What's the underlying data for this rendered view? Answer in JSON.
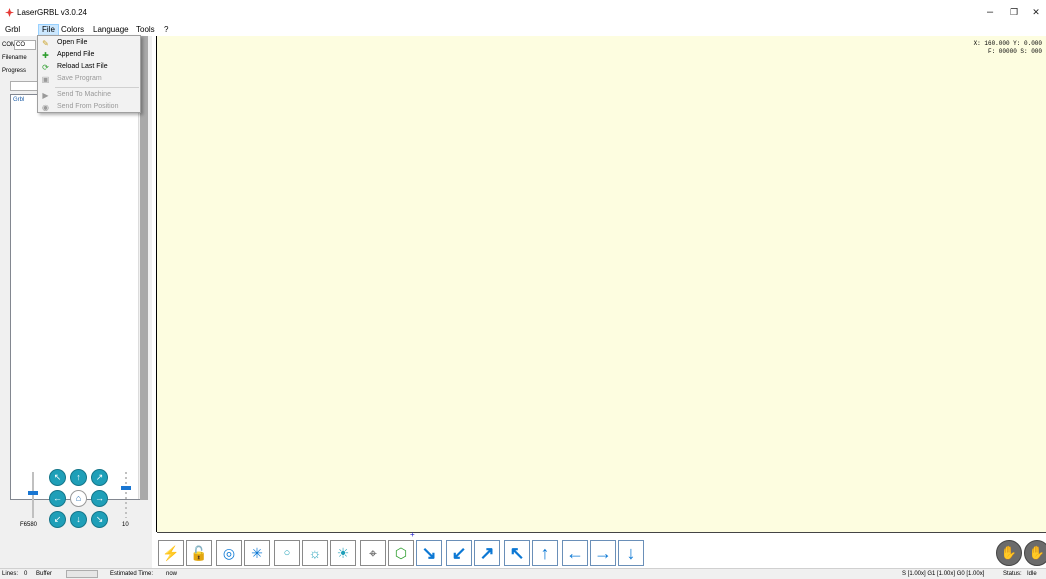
{
  "window": {
    "title": "LaserGRBL v3.0.24",
    "minimize": "–",
    "restore": "❐",
    "close": "✕"
  },
  "menubar": {
    "items": [
      "Grbl",
      "File",
      "Colors",
      "Language",
      "Tools",
      "?"
    ]
  },
  "file_menu": {
    "items": [
      {
        "label": "Open File",
        "icon": "folder-open-icon",
        "enabled": true
      },
      {
        "label": "Append File",
        "icon": "append-icon",
        "enabled": true
      },
      {
        "label": "Reload Last File",
        "icon": "reload-icon",
        "enabled": true
      },
      {
        "label": "Save Program",
        "icon": "save-icon",
        "enabled": false
      },
      {
        "label": "Send To Machine",
        "icon": "play-icon",
        "enabled": false
      },
      {
        "label": "Send From Position",
        "icon": "position-icon",
        "enabled": false
      }
    ]
  },
  "left_panel": {
    "com_label": "COM",
    "com_value": "CO",
    "filename_label": "Filename",
    "progress_label": "Progress",
    "log_line": "Grbl"
  },
  "jog": {
    "speed_label": "F6580",
    "step_label": "10"
  },
  "canvas": {
    "coords_line1": "X: 160.000 Y: 0.000",
    "coords_line2": "F: 00000 S: 000",
    "background": "#fdfde0"
  },
  "statusbar": {
    "lines_label": "Lines:",
    "lines_value": "0",
    "buffer_label": "Buffer",
    "estimated_label": "Estimated Time:",
    "estimated_value": "now",
    "overrides": "S [1.00x] G1 [1.00x] G0 [1.00x]",
    "status_label": "Status:",
    "status_value": "Idle"
  },
  "colors": {
    "accent": "#1f9fb8",
    "arrow_blue": "#0c78d4",
    "menu_highlight": "#cce8ff"
  }
}
